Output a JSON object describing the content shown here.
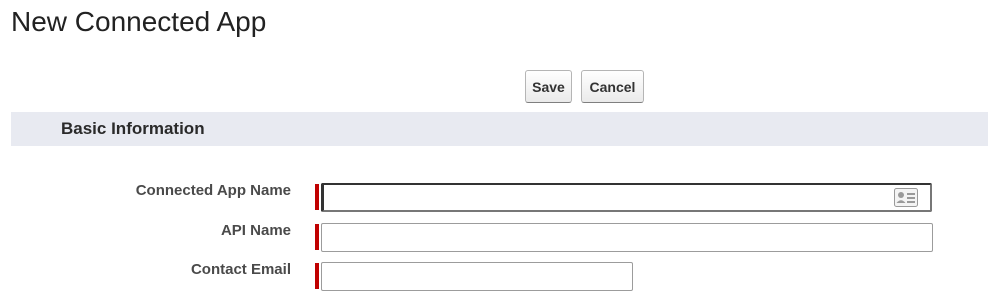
{
  "header": {
    "title": "New Connected App"
  },
  "toolbar": {
    "save_label": "Save",
    "cancel_label": "Cancel"
  },
  "section": {
    "title": "Basic Information"
  },
  "form": {
    "connected_app_name": {
      "label": "Connected App Name",
      "value": "",
      "required": true,
      "icon": "contact-card-icon"
    },
    "api_name": {
      "label": "API Name",
      "value": "",
      "required": true
    },
    "contact_email": {
      "label": "Contact Email",
      "value": "",
      "required": true
    }
  },
  "colors": {
    "required_marker": "#c00000",
    "section_background": "#e8eaf1"
  }
}
